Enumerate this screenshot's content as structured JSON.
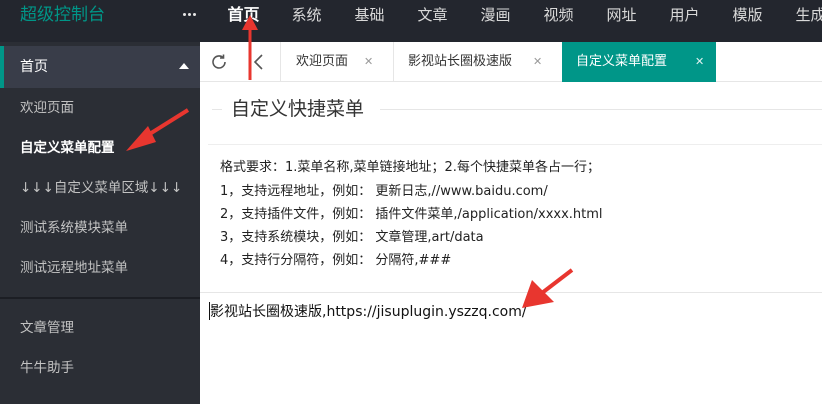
{
  "app": {
    "title": "超级控制台"
  },
  "topnav": {
    "items": [
      {
        "label": "首页",
        "active": true
      },
      {
        "label": "系统"
      },
      {
        "label": "基础"
      },
      {
        "label": "文章"
      },
      {
        "label": "漫画"
      },
      {
        "label": "视频"
      },
      {
        "label": "网址"
      },
      {
        "label": "用户"
      },
      {
        "label": "模版"
      },
      {
        "label": "生成"
      }
    ]
  },
  "sidebar": {
    "header": "首页",
    "items": [
      {
        "label": "欢迎页面"
      },
      {
        "label": "自定义菜单配置",
        "active": true
      },
      {
        "label": "↓↓↓自定义菜单区域↓↓↓"
      },
      {
        "label": "测试系统模块菜单"
      },
      {
        "label": "测试远程地址菜单"
      },
      {
        "label": "文章管理"
      },
      {
        "label": "牛牛助手"
      }
    ]
  },
  "tabs": [
    {
      "label": "欢迎页面",
      "close": "✕"
    },
    {
      "label": "影视站长圈极速版",
      "close": "✕"
    },
    {
      "label": "自定义菜单配置",
      "close": "✕",
      "active": true
    }
  ],
  "content": {
    "title": "自定义快捷菜单",
    "help_lines": [
      "格式要求：1.菜单名称,菜单链接地址；2.每个快捷菜单各占一行；",
      "1，支持远程地址，例如： 更新日志,//www.baidu.com/",
      "2，支持插件文件，例如： 插件文件菜单,/application/xxxx.html",
      "3，支持系统模块，例如： 文章管理,art/data",
      "4，支持行分隔符，例如： 分隔符,###"
    ],
    "textarea_value": "影视站长圈极速版,https://jisuplugin.yszzq.com/"
  },
  "colors": {
    "topbar": "#23262e",
    "sidebar": "#2b2e35",
    "accent": "#009688",
    "annotation": "#e8362f"
  },
  "icons": [
    "more-icon",
    "caret-up-icon",
    "refresh-icon",
    "back-icon",
    "close-icon"
  ]
}
